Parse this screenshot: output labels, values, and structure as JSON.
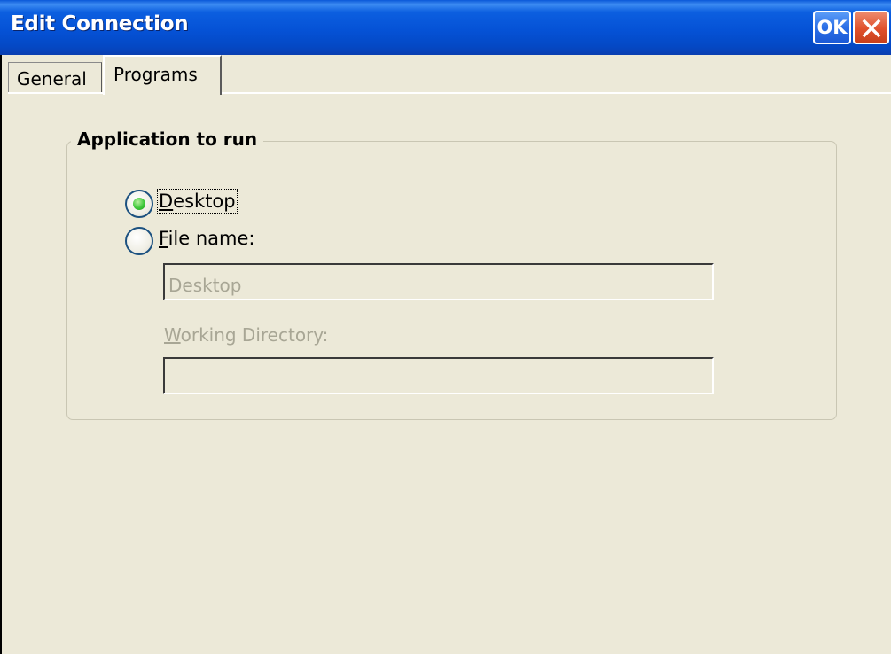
{
  "window": {
    "title": "Edit Connection",
    "ok_label": "OK",
    "close_icon": "close-icon"
  },
  "tabs": [
    {
      "label": "General",
      "selected": false
    },
    {
      "label": "Programs",
      "selected": true
    }
  ],
  "group": {
    "title": "Application to run",
    "options": [
      {
        "accel": "D",
        "rest": "esktop",
        "label": "Desktop",
        "selected": true
      },
      {
        "accel": "F",
        "rest": "ile name:",
        "label": "File name:",
        "selected": false
      }
    ],
    "file_name_value": "Desktop",
    "working_dir_label_accel": "W",
    "working_dir_label_rest": "orking Directory:",
    "working_dir_value": ""
  },
  "colors": {
    "titlebar": "#0552d6",
    "dialog_bg": "#ece9d8",
    "disabled_text": "#a8a695",
    "radio_selected": "#3ec83a"
  }
}
